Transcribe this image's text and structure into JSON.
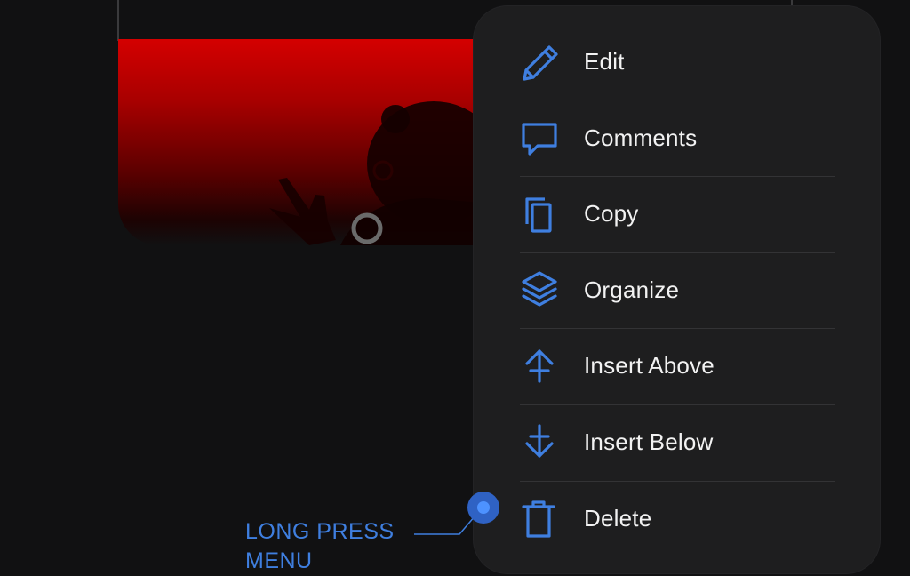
{
  "menu": {
    "items": [
      {
        "label": "Edit",
        "icon": "pencil-icon"
      },
      {
        "label": "Comments",
        "icon": "comment-icon"
      },
      {
        "label": "Copy",
        "icon": "copy-icon"
      },
      {
        "label": "Organize",
        "icon": "layers-icon"
      },
      {
        "label": "Insert Above",
        "icon": "insert-above-icon"
      },
      {
        "label": "Insert Below",
        "icon": "insert-below-icon"
      },
      {
        "label": "Delete",
        "icon": "trash-icon"
      }
    ]
  },
  "callout": {
    "label": "LONG PRESS MENU"
  },
  "colors": {
    "accent": "#3f7fe0",
    "menu_background": "#1e1e1f",
    "page_background": "#111112",
    "hero_red": "#d40000"
  }
}
